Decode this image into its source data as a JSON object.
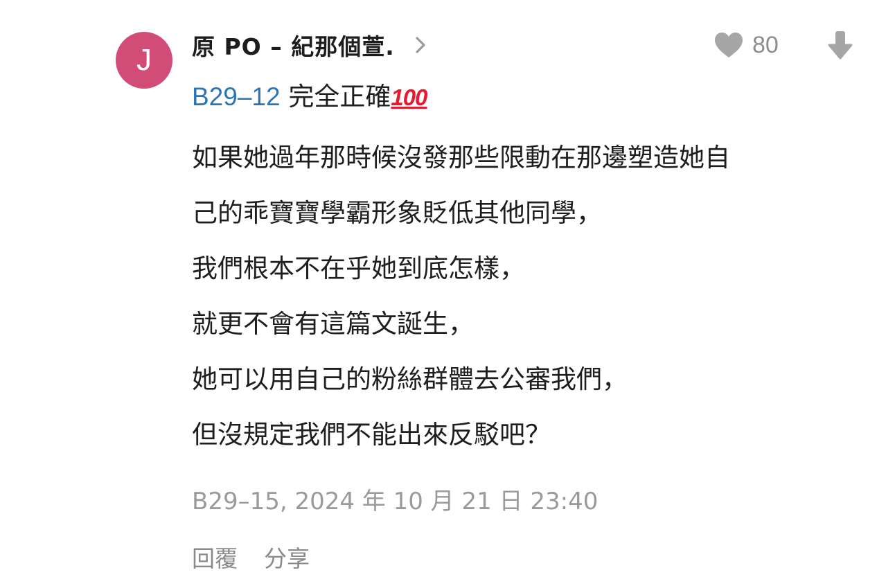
{
  "comment": {
    "avatar_letter": "J",
    "avatar_color": "#d14c77",
    "author": "原 PO – 紀那個萱.",
    "like_count": "80",
    "reply_to": "B29–12",
    "first_line_text": " 完全正確",
    "hundred_emoji": "100",
    "body_lines": [
      "如果她過年那時候沒發那些限動在那邊塑造她自",
      "己的乖寶寶學霸形象貶低其他同學，",
      "我們根本不在乎她到底怎樣，",
      "就更不會有這篇文誕生，",
      "她可以用自己的粉絲群體去公審我們，",
      "但沒規定我們不能出來反駁吧？"
    ],
    "meta": "B29–15, 2024 年 10 月 21 日 23:40",
    "reply_label": "回覆",
    "share_label": "分享"
  },
  "icons": {
    "chevron": "chevron-right-icon",
    "like": "heart-icon",
    "downvote": "arrow-down-icon"
  },
  "colors": {
    "link": "#2d74b3",
    "muted": "#9a9a9a",
    "icon": "#a6a6a6"
  }
}
